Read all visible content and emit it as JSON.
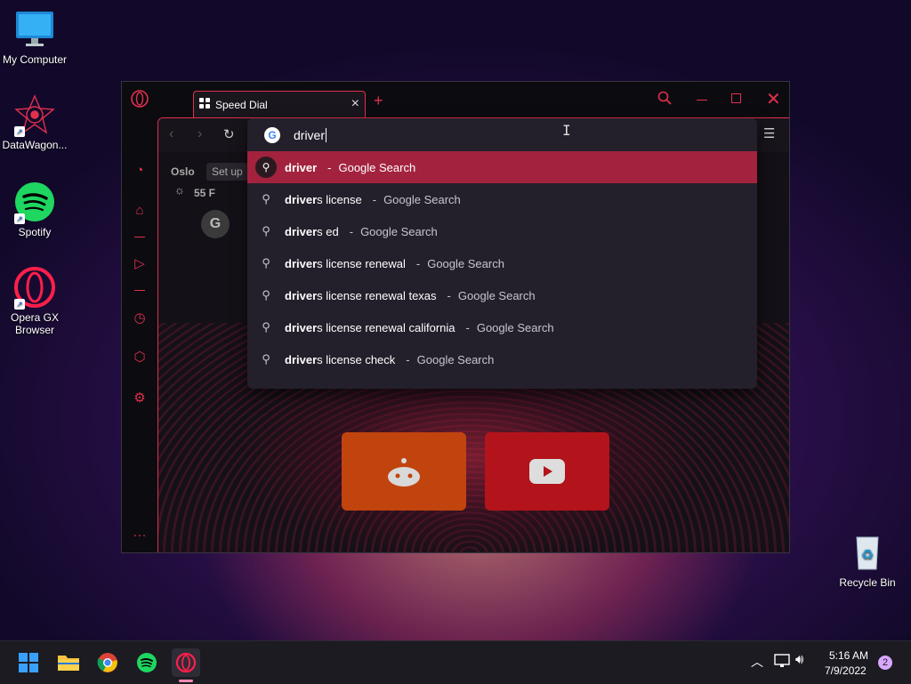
{
  "desktop": {
    "icons": [
      {
        "label": "My Computer"
      },
      {
        "label": "DataWagon..."
      },
      {
        "label": "Spotify"
      },
      {
        "label": "Opera GX\nBrowser"
      },
      {
        "label": "Recycle Bin"
      }
    ]
  },
  "browser": {
    "tab": {
      "label": "Speed Dial"
    },
    "address": {
      "value": "driver"
    },
    "weather": {
      "city": "Oslo",
      "setup": "Set up",
      "temp": "55 F"
    },
    "suggestions": [
      {
        "bold": "driver",
        "rest": "",
        "source": "Google Search"
      },
      {
        "bold": "driver",
        "rest": "s license",
        "source": "Google Search"
      },
      {
        "bold": "driver",
        "rest": "s ed",
        "source": "Google Search"
      },
      {
        "bold": "driver",
        "rest": "s license renewal",
        "source": "Google Search"
      },
      {
        "bold": "driver",
        "rest": "s license renewal texas",
        "source": "Google Search"
      },
      {
        "bold": "driver",
        "rest": "s license renewal california",
        "source": "Google Search"
      },
      {
        "bold": "driver",
        "rest": "s license check",
        "source": "Google Search"
      }
    ],
    "separator": "-",
    "colors": {
      "accent": "#e0304e",
      "selected": "#a3233e"
    }
  },
  "taskbar": {
    "time": "5:16 AM",
    "date": "7/9/2022",
    "notification_count": "2"
  }
}
